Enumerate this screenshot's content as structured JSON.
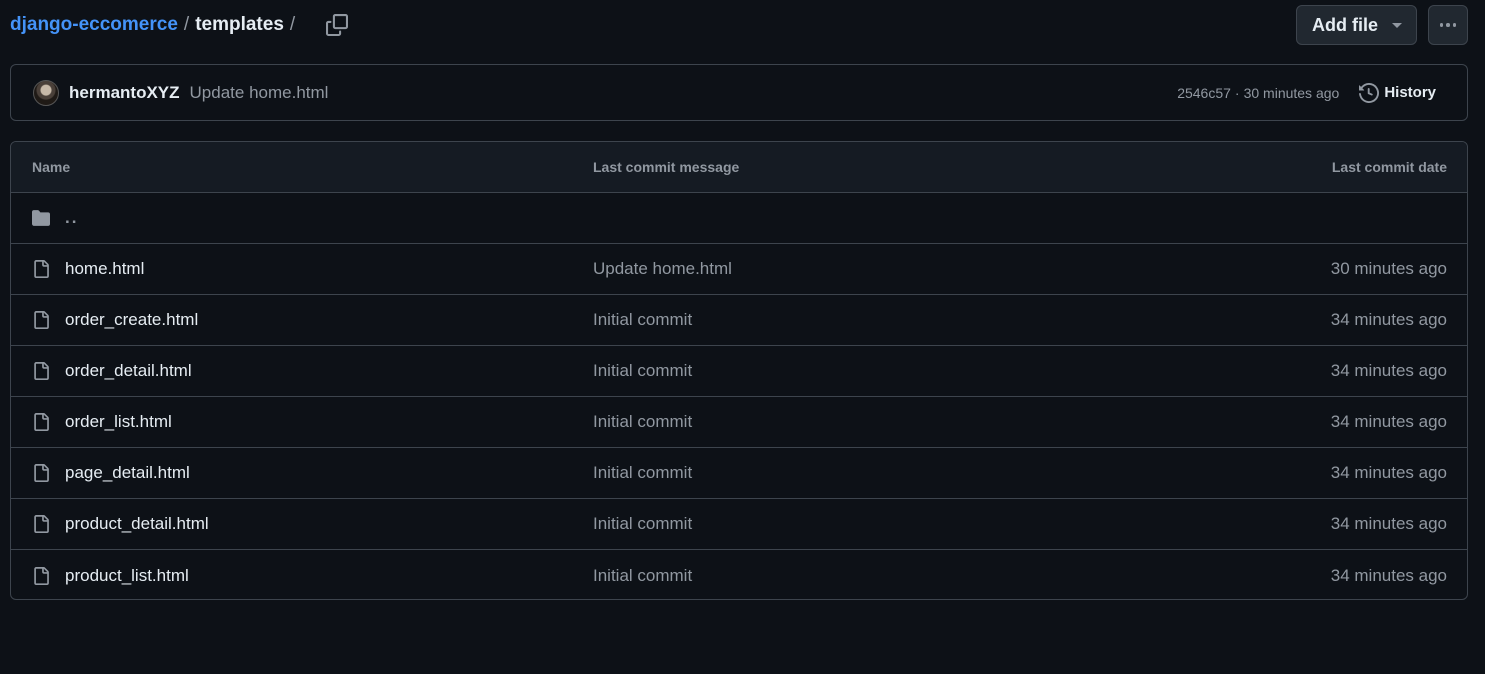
{
  "breadcrumb": {
    "repo": "django-eccomerce",
    "dir": "templates",
    "separator": "/"
  },
  "actions": {
    "add_file_label": "Add file",
    "more_icon": "kebab-horizontal-icon"
  },
  "latest_commit": {
    "author": "hermantoXYZ",
    "message": "Update home.html",
    "sha": "2546c57",
    "dot": "·",
    "time": "30 minutes ago",
    "history_label": "History"
  },
  "table": {
    "headers": {
      "name": "Name",
      "message": "Last commit message",
      "date": "Last commit date"
    },
    "parent_dir": "..",
    "rows": [
      {
        "name": "home.html",
        "message": "Update home.html",
        "date": "30 minutes ago"
      },
      {
        "name": "order_create.html",
        "message": "Initial commit",
        "date": "34 minutes ago"
      },
      {
        "name": "order_detail.html",
        "message": "Initial commit",
        "date": "34 minutes ago"
      },
      {
        "name": "order_list.html",
        "message": "Initial commit",
        "date": "34 minutes ago"
      },
      {
        "name": "page_detail.html",
        "message": "Initial commit",
        "date": "34 minutes ago"
      },
      {
        "name": "product_detail.html",
        "message": "Initial commit",
        "date": "34 minutes ago"
      },
      {
        "name": "product_list.html",
        "message": "Initial commit",
        "date": "34 minutes ago"
      }
    ]
  },
  "colors": {
    "background": "#0d1117",
    "link": "#4493f8",
    "muted": "#9198a1",
    "border": "#3d444d"
  }
}
